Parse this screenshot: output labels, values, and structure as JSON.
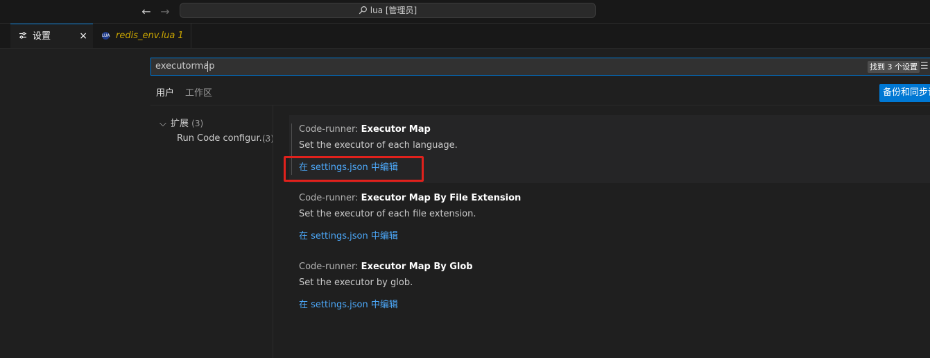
{
  "titlebar": {
    "back_icon": "arrow-left-icon",
    "forward_icon": "arrow-right-icon",
    "command_center": "lua [管理员]"
  },
  "tabs": [
    {
      "label": "设置",
      "icon": "settings-icon",
      "active": true,
      "close": "×"
    },
    {
      "label": "redis_env.lua 1",
      "icon": "lua-file-icon",
      "icon_text": "LUA",
      "active": false
    }
  ],
  "search": {
    "value": "executormap",
    "result_count": "找到 3 个设置",
    "filter_icon": "filter-list-icon"
  },
  "scope_tabs": {
    "user": "用户",
    "workspace": "工作区"
  },
  "sync_button": "备份和同步设置",
  "toc": {
    "group": {
      "label": "扩展",
      "count": "(3)"
    },
    "items": [
      {
        "label": "Run Code configur...",
        "count": "(3)"
      }
    ]
  },
  "settings": [
    {
      "category": "Code-runner: ",
      "name": "Executor Map",
      "description": "Set the executor of each language.",
      "link": "在 settings.json 中编辑"
    },
    {
      "category": "Code-runner: ",
      "name": "Executor Map By File Extension",
      "description": "Set the executor of each file extension.",
      "link": "在 settings.json 中编辑"
    },
    {
      "category": "Code-runner: ",
      "name": "Executor Map By Glob",
      "description": "Set the executor by glob.",
      "link": "在 settings.json 中编辑"
    }
  ],
  "colors": {
    "accent": "#0078d4",
    "link": "#4daafc",
    "annotation": "#e0211c"
  }
}
